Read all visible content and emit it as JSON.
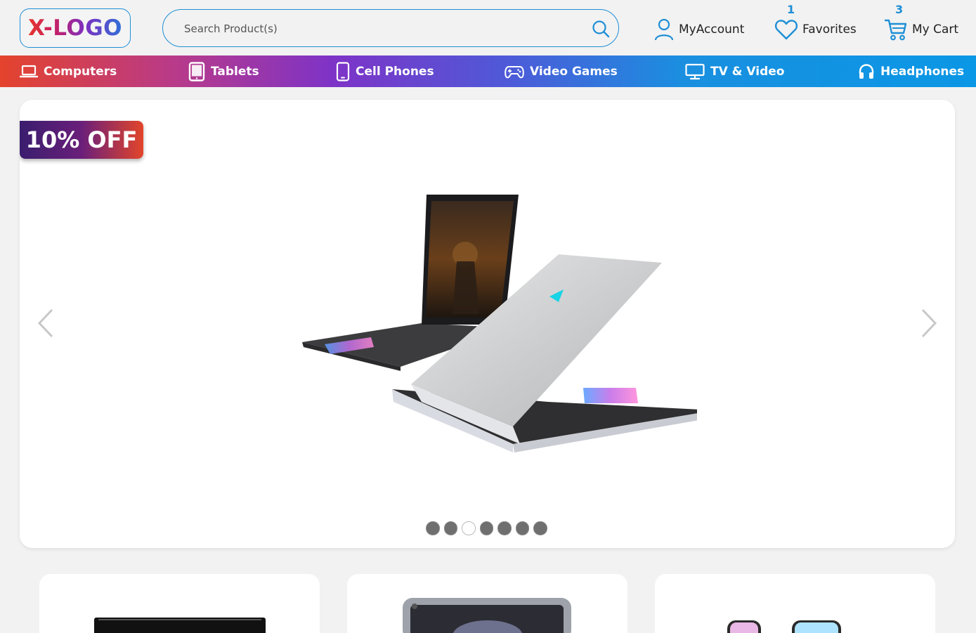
{
  "header": {
    "logo_text": "X-LOGO",
    "search_placeholder": "Search Product(s)",
    "account_label": "MyAccount",
    "favorites_label": "Favorites",
    "favorites_count": "1",
    "cart_label": "My Cart",
    "cart_count": "3"
  },
  "nav": {
    "items": [
      {
        "label": "Computers",
        "icon": "laptop-icon"
      },
      {
        "label": "Tablets",
        "icon": "tablet-icon"
      },
      {
        "label": "Cell Phones",
        "icon": "phone-icon"
      },
      {
        "label": "Video Games",
        "icon": "gamepad-icon"
      },
      {
        "label": "TV & Video",
        "icon": "monitor-icon"
      },
      {
        "label": "Headphones",
        "icon": "headphones-icon"
      }
    ]
  },
  "hero": {
    "discount_label": "10% OFF",
    "slide_count": 7,
    "active_slide": 3
  },
  "colors": {
    "accent": "#1e8fd6",
    "nav_gradient_start": "#e4432c",
    "nav_gradient_end": "#0a97e5"
  }
}
